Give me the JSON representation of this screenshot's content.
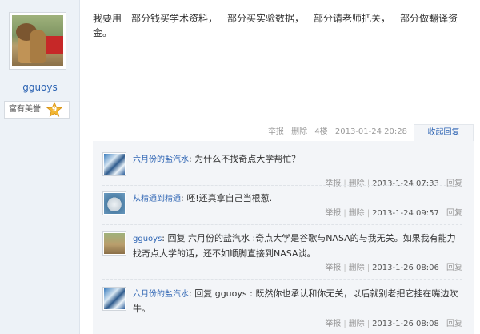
{
  "user": {
    "name": "gguoys",
    "honor_label": "富有美誉",
    "honor_level": "9"
  },
  "post": {
    "text": "我要用一部分钱买学术资料，一部分买实验数据，一部分请老师把关，一部分做翻译资金。",
    "meta": {
      "report": "举报",
      "delete": "删除",
      "floor": "4楼",
      "time": "2013-01-24 20:28"
    },
    "collapse_label": "收起回复"
  },
  "replies": [
    {
      "user": "六月份的盐汽水",
      "colon": ":",
      "text": "为什么不找奇点大学帮忙？",
      "report": "举报",
      "delete": "删除",
      "time": "2013-1-24 07:33",
      "reply": "回复"
    },
    {
      "user": "从精通到精通",
      "colon": ":",
      "text": "呸!还真拿自己当根葱.",
      "report": "举报",
      "delete": "删除",
      "time": "2013-1-24 09:57",
      "reply": "回复"
    },
    {
      "user": "gguoys",
      "colon": ":",
      "text": "回复 六月份的盐汽水 :奇点大学是谷歌与NASA的与我无关。如果我有能力找奇点大学的话，还不如顺脚直接到NASA谈。",
      "report": "举报",
      "delete": "删除",
      "time": "2013-1-26 08:06",
      "reply": "回复"
    },
    {
      "user": "六月份的盐汽水",
      "colon": ":",
      "text": "回复 gguoys : 既然你也承认和你无关，以后就别老把它挂在嘴边吹牛。",
      "report": "举报",
      "delete": "删除",
      "time": "2013-1-26 08:08",
      "reply": "回复"
    }
  ]
}
